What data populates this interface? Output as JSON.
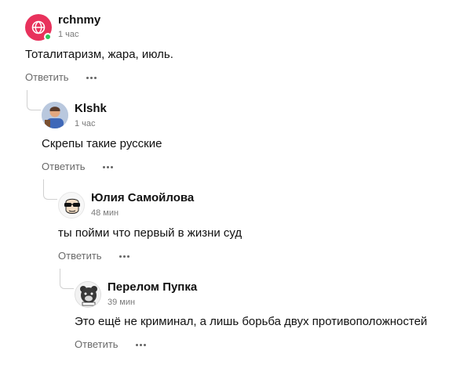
{
  "comments": [
    {
      "author": "rchnmy",
      "time": "1 час",
      "text": "Тоталитаризм, жара, июль.",
      "reply_label": "Ответить",
      "avatar_icon": "basketball-icon",
      "avatar_color": "#e8325c",
      "online": true,
      "online_color": "#2ec45a"
    },
    {
      "author": "Klshk",
      "time": "1 час",
      "text": "Скрепы такие русские",
      "reply_label": "Ответить",
      "avatar_icon": "user-photo-icon"
    },
    {
      "author": "Юлия Самойлова",
      "time": "48 мин",
      "text": "ты пойми что первый в жизни суд",
      "reply_label": "Ответить",
      "avatar_icon": "cool-face-sunglasses-icon"
    },
    {
      "author": "Перелом Пупка",
      "time": "39 мин",
      "text": "Это ещё не криминал, а лишь борьба двух противоположностей",
      "reply_label": "Ответить",
      "avatar_icon": "bear-icon"
    }
  ]
}
